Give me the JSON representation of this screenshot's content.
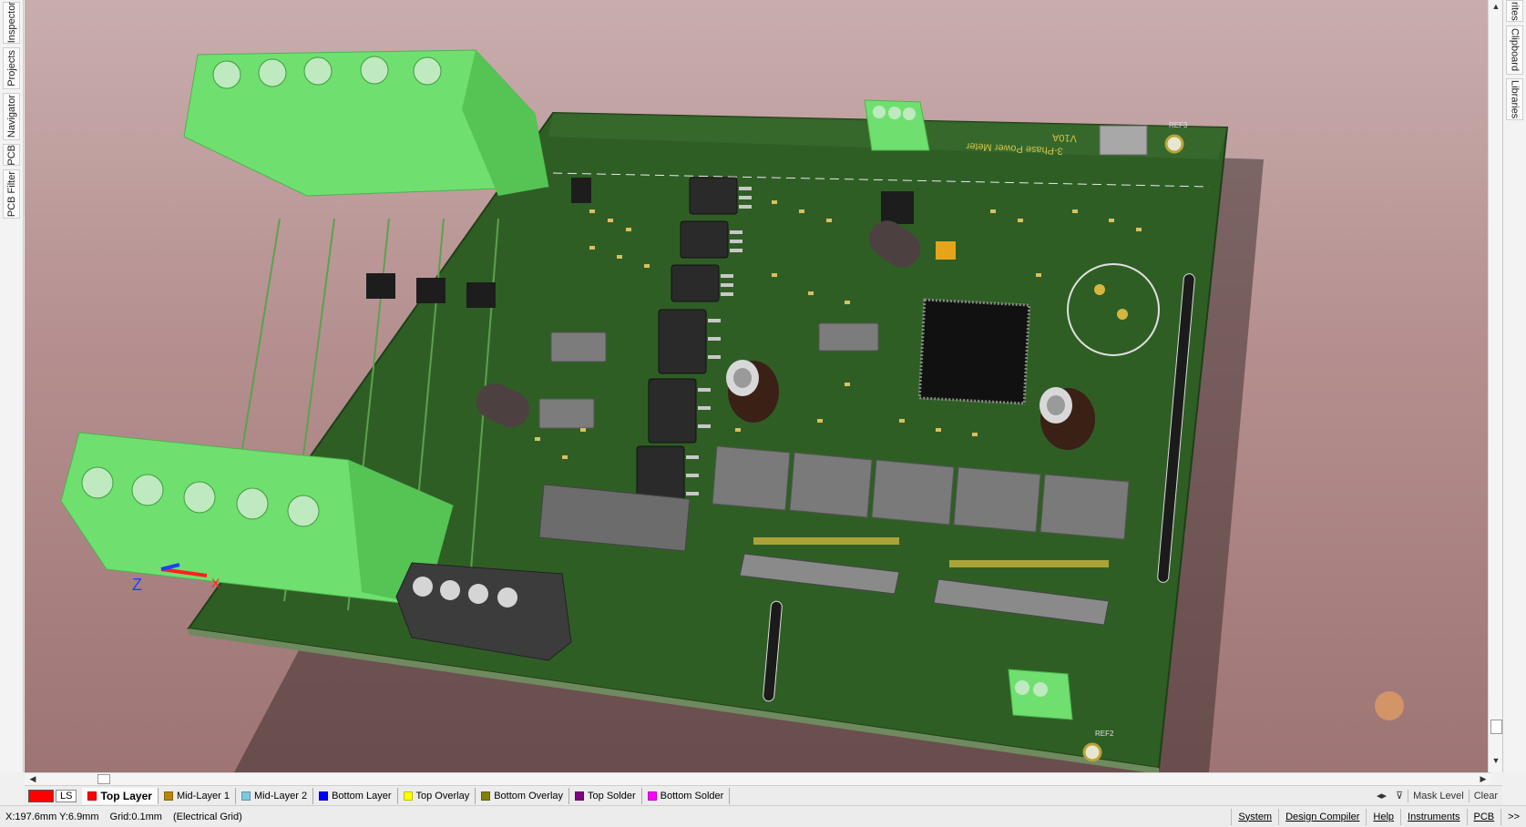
{
  "left_panels": [
    "Inspector",
    "Projects",
    "Navigator",
    "PCB",
    "PCB Filter"
  ],
  "right_panels": [
    "rites",
    "Clipboard",
    "Libraries"
  ],
  "board": {
    "title_text": "3-Phase Power Meter",
    "version_text": "V10A",
    "ref_labels": [
      "REF2",
      "REF3"
    ]
  },
  "axes": {
    "z": "Z",
    "x": "X"
  },
  "layer_bar": {
    "current_swatch_label": "LS",
    "tabs": [
      {
        "label": "Top Layer",
        "color": "#ff0000",
        "active": true
      },
      {
        "label": "Mid-Layer 1",
        "color": "#b8860b",
        "active": false
      },
      {
        "label": "Mid-Layer 2",
        "color": "#7ec8e3",
        "active": false
      },
      {
        "label": "Bottom Layer",
        "color": "#0000ff",
        "active": false
      },
      {
        "label": "Top Overlay",
        "color": "#ffff00",
        "active": false
      },
      {
        "label": "Bottom Overlay",
        "color": "#808000",
        "active": false
      },
      {
        "label": "Top Solder",
        "color": "#800080",
        "active": false
      },
      {
        "label": "Bottom Solder",
        "color": "#ff00ff",
        "active": false
      }
    ],
    "mask_level": "Mask Level",
    "clear": "Clear"
  },
  "status": {
    "coords": "X:197.6mm Y:6.9mm",
    "grid": "Grid:0.1mm",
    "grid_type": "(Electrical Grid)",
    "buttons": [
      "System",
      "Design Compiler",
      "Help",
      "Instruments",
      "PCB"
    ],
    "more": ">>"
  },
  "colors": {
    "pcb_green": "#2f5e25",
    "terminal_green": "#6fe06f",
    "terminal_dark": "#3c3c3c",
    "background_top": "#c9adad",
    "background_bottom": "#9e7474"
  }
}
